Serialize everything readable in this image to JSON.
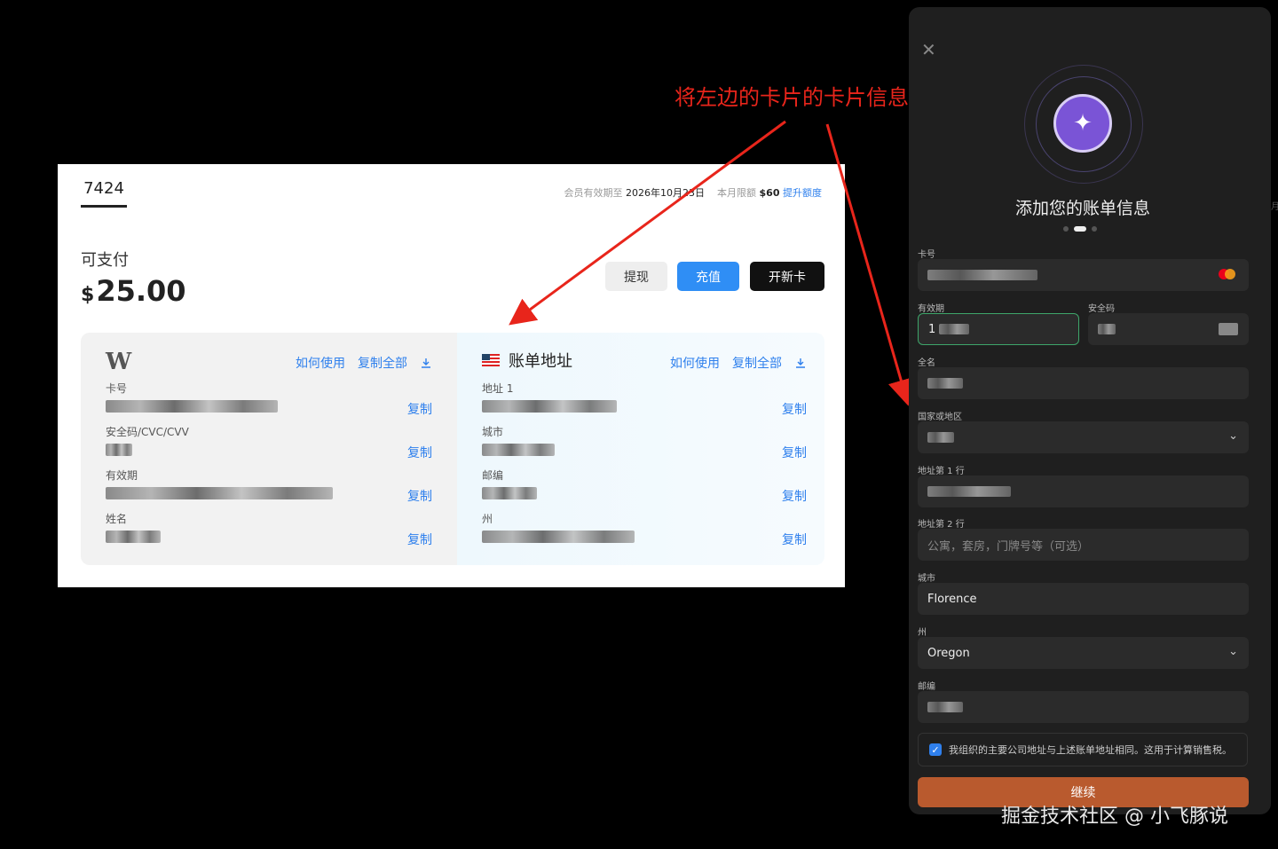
{
  "annotation": "将左边的卡片的卡片信息填写过去",
  "card_panel": {
    "tab": "7424",
    "meta_label": "会员有效期至",
    "meta_date": "2026年10月23日",
    "limit_label": "本月限额",
    "limit_value": "$60",
    "raise_link": "提升额度",
    "pay_label": "可支付",
    "currency": "$",
    "balance": "25.00",
    "btn_withdraw": "提现",
    "btn_topup": "充值",
    "btn_newcard": "开新卡"
  },
  "card_info": {
    "logo": "W",
    "how_to": "如何使用",
    "copy_all": "复制全部",
    "download_icon": "download-icon",
    "copy": "复制",
    "fields": [
      "卡号",
      "安全码/CVC/CVV",
      "有效期",
      "姓名"
    ]
  },
  "billing": {
    "title": "账单地址",
    "flag_icon": "us-flag-icon",
    "how_to": "如何使用",
    "copy_all": "复制全部",
    "copy": "复制",
    "fields": [
      "地址 1",
      "城市",
      "邮编",
      "州"
    ]
  },
  "form": {
    "title": "添加您的账单信息",
    "close_icon": "close-icon",
    "sparkle_icon": "sparkle-icon",
    "card_number_label": "卡号",
    "expiry_label": "有效期",
    "expiry_value": "1",
    "cvc_label": "安全码",
    "name_label": "全名",
    "country_label": "国家或地区",
    "address1_label": "地址第 1 行",
    "address2_label": "地址第 2 行",
    "address2_placeholder": "公寓，套房，门牌号等（可选）",
    "city_label": "城市",
    "city_value": "Florence",
    "state_label": "州",
    "state_value": "Oregon",
    "zip_label": "邮编",
    "checkbox_text": "我组织的主要公司地址与上述账单地址相同。这用于计算销售税。",
    "continue": "继续"
  },
  "watermark": "掘金技术社区 @ 小飞豚说",
  "colors": {
    "accent_blue": "#2f80ed",
    "annotation_red": "#e8251b",
    "continue_orange": "#b95a2e",
    "orb_purple": "#7a54d6"
  }
}
